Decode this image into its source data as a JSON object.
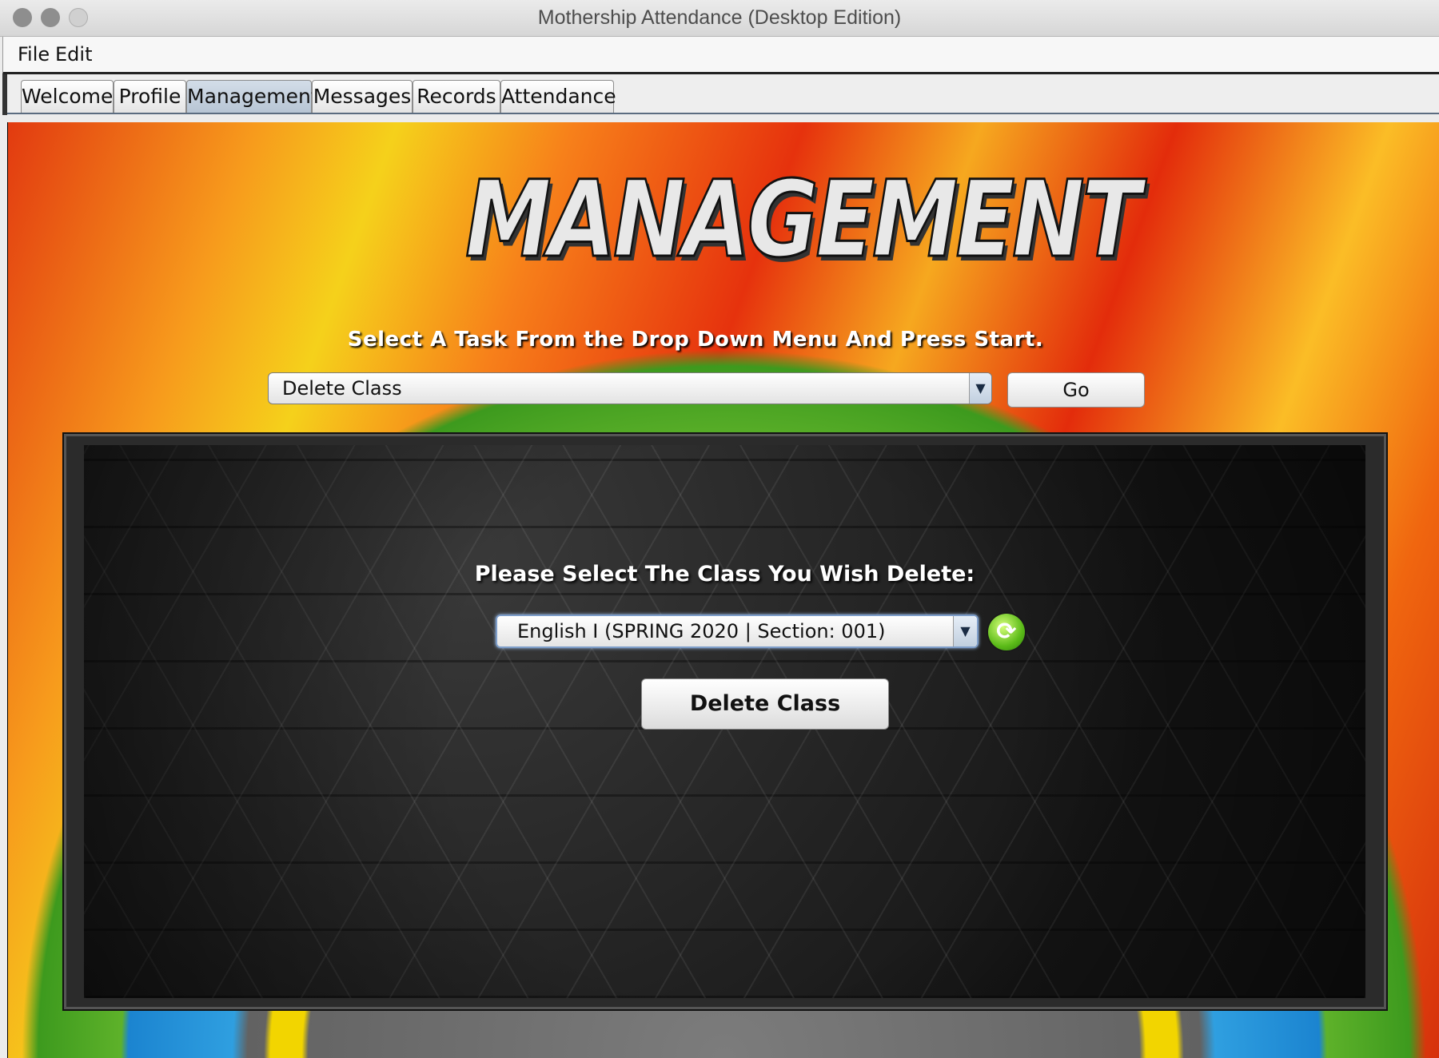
{
  "window": {
    "title": "Mothership Attendance (Desktop Edition)",
    "traffic_lights": [
      "close",
      "minimize",
      "zoom"
    ]
  },
  "menubar": {
    "items": [
      {
        "label": "File"
      },
      {
        "label": "Edit"
      }
    ]
  },
  "tabs": [
    {
      "label": "Welcome",
      "active": false
    },
    {
      "label": "Profile",
      "active": false
    },
    {
      "label": "Management",
      "active": true
    },
    {
      "label": "Messages",
      "active": false
    },
    {
      "label": "Records",
      "active": false
    },
    {
      "label": "Attendance",
      "active": false
    }
  ],
  "management": {
    "header_logo_text": "MANAGEMENT",
    "instruction": "Select A Task From the Drop Down Menu And Press Start.",
    "task_select": {
      "selected": "Delete Class",
      "arrow_icon": "triangle-down-icon"
    },
    "go_label": "Go",
    "delete_panel": {
      "prompt": "Please Select The Class You Wish Delete:",
      "class_select": {
        "selected": "English I (SPRING 2020 | Section: 001)",
        "arrow_icon": "triangle-down-icon"
      },
      "refresh_icon": "refresh-icon",
      "delete_button_label": "Delete Class"
    }
  },
  "colors": {
    "tab_active": "#c3cfdc",
    "refresh_green": "#5cbb19",
    "panel_dark": "#1e1e1e"
  }
}
